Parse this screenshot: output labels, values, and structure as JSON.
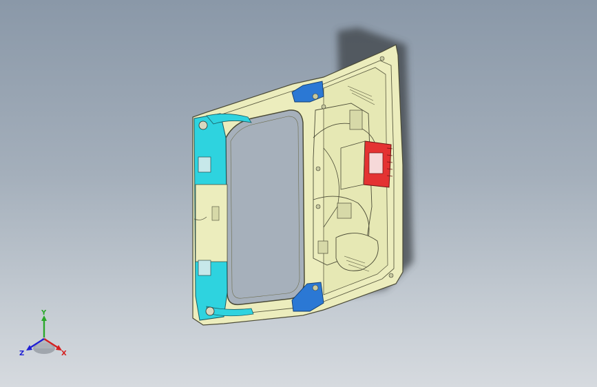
{
  "viewport": {
    "background_top": "#8a98a8",
    "background_bottom": "#d6dadf"
  },
  "model": {
    "body_color": "#ecedbd",
    "edge_color": "#4a4a36",
    "highlight_cyan": "#2ed3df",
    "highlight_blue": "#2b78d4",
    "highlight_red": "#e43232"
  },
  "triad": {
    "y_label": "Y",
    "x_label": "X",
    "z_label": "Z",
    "y_color": "#2aa82a",
    "x_color": "#d42020",
    "z_color": "#2020d4"
  }
}
